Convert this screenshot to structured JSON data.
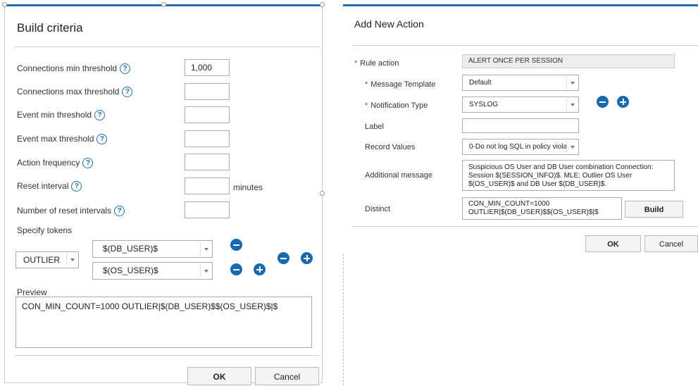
{
  "left": {
    "title": "Build criteria",
    "fields": [
      {
        "label": "Connections min threshold",
        "value": "1,000"
      },
      {
        "label": "Connections max threshold",
        "value": ""
      },
      {
        "label": "Event min threshold",
        "value": ""
      },
      {
        "label": "Event max threshold",
        "value": ""
      },
      {
        "label": "Action frequency",
        "value": ""
      },
      {
        "label": "Reset interval",
        "value": "",
        "suffix": "minutes"
      },
      {
        "label": "Number of reset intervals",
        "value": ""
      }
    ],
    "help_glyph": "?",
    "tokens_label": "Specify tokens",
    "token_type": "OUTLIER",
    "token_values": [
      "$(DB_USER)$",
      "$(OS_USER)$"
    ],
    "preview_label": "Preview",
    "preview_text": "CON_MIN_COUNT=1000 OUTLIER|$(DB_USER)$$(OS_USER)$|$",
    "ok_label": "OK",
    "cancel_label": "Cancel"
  },
  "right": {
    "title": "Add New Action",
    "rule_action_label": "Rule action",
    "rule_action_value": "ALERT ONCE PER SESSION",
    "message_template_label": "Message Template",
    "message_template_value": "Default",
    "notification_type_label": "Notification Type",
    "notification_type_value": "SYSLOG",
    "label_label": "Label",
    "label_value": "",
    "record_values_label": "Record Values",
    "record_values_value": "0-Do not log SQL in policy viola",
    "additional_message_label": "Additional message",
    "additional_message_value": "Suspicious OS User and DB User combination Connection: Session $(SESSION_INFO)$. MLE: Outlier OS User $(OS_USER)$ and DB User $(DB_USER)$.",
    "distinct_label": "Distinct",
    "distinct_value": "CON_MIN_COUNT=1000 OUTLIER|$(DB_USER)$$(OS_USER)$|$",
    "build_label": "Build",
    "ok_label": "OK",
    "cancel_label": "Cancel",
    "required_mark": "*"
  },
  "colors": {
    "accent": "#1f6fb5",
    "circle": "#1769b0",
    "required": "#c0392b"
  }
}
